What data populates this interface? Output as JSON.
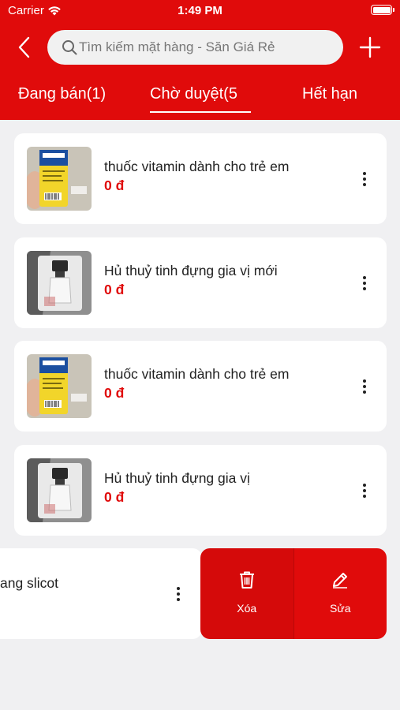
{
  "status_bar": {
    "carrier": "Carrier",
    "time": "1:49 PM"
  },
  "header": {
    "search_placeholder": "Tìm kiếm mặt hàng - Săn Giá Rẻ",
    "back_icon": "chevron-left-icon",
    "add_icon": "plus-icon"
  },
  "tabs": [
    {
      "label": "Đang bán(1)",
      "active": false
    },
    {
      "label": "Chờ duyệt(5",
      "active": true
    },
    {
      "label": "Hết hạn",
      "active": false
    }
  ],
  "products": [
    {
      "title": "thuốc vitamin dành cho trẻ em",
      "price": "0 đ",
      "thumb": "vitamin-bottle"
    },
    {
      "title": "Hủ thuỷ tinh đựng gia vị mới",
      "price": "0 đ",
      "thumb": "glass-jar"
    },
    {
      "title": "thuốc vitamin dành cho trẻ em",
      "price": "0 đ",
      "thumb": "vitamin-bottle"
    },
    {
      "title": "Hủ thuỷ tinh đựng gia vị",
      "price": "0 đ",
      "thumb": "glass-jar"
    }
  ],
  "swiped_item": {
    "title_visible": "ang slicot",
    "actions": {
      "delete_label": "Xóa",
      "edit_label": "Sửa"
    }
  },
  "colors": {
    "primary": "#e00b0b",
    "background": "#f0f0f2",
    "card": "#ffffff"
  }
}
